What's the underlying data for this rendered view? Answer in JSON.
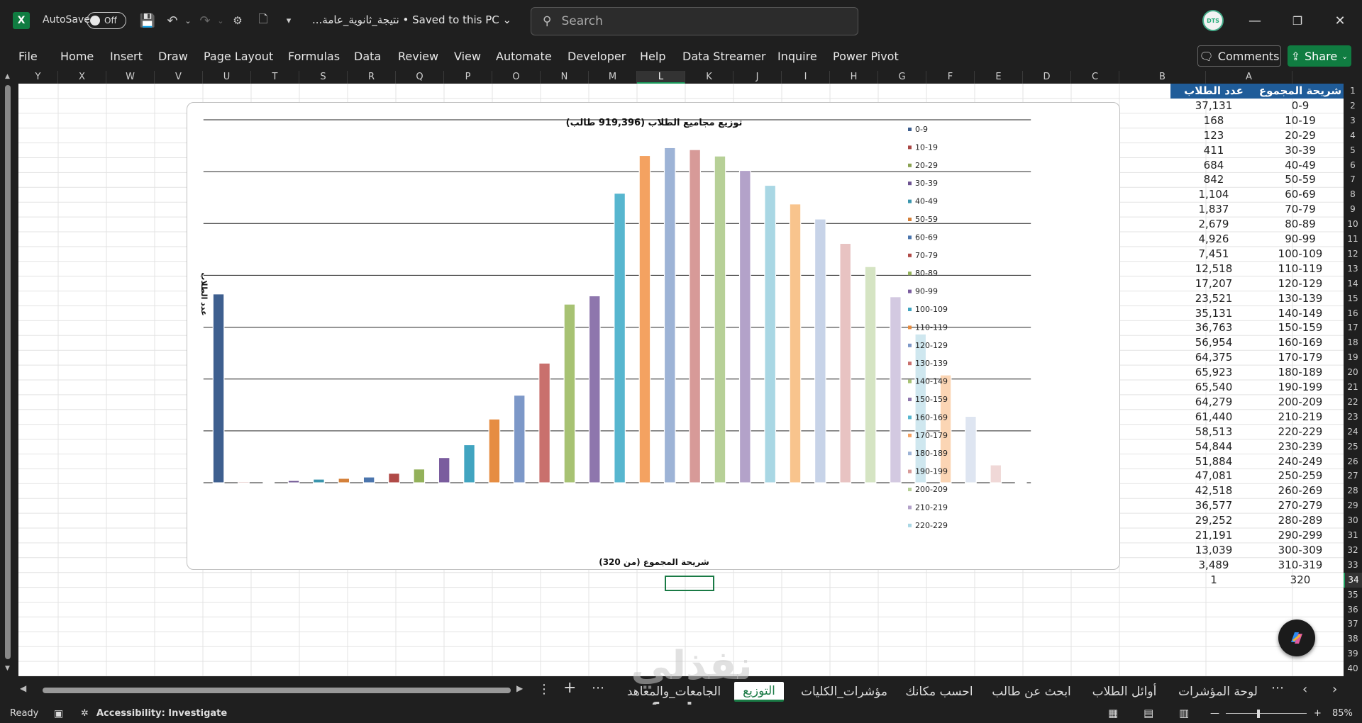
{
  "titlebar": {
    "app_icon": "X",
    "autosave_label": "AutoSave",
    "autosave_state": "Off",
    "doc_title": "...نتيجة_ثانوية_عامة",
    "save_status": "• Saved to this PC",
    "search_placeholder": "Search",
    "avatar_text": "DTS"
  },
  "menu": [
    "File",
    "Home",
    "Insert",
    "Draw",
    "Page Layout",
    "Formulas",
    "Data",
    "Review",
    "View",
    "Automate",
    "Developer",
    "Help",
    "Data Streamer",
    "Inquire",
    "Power Pivot"
  ],
  "buttons": {
    "comments": "Comments",
    "share": "Share"
  },
  "columns": [
    "Y",
    "X",
    "W",
    "V",
    "U",
    "T",
    "S",
    "R",
    "Q",
    "P",
    "O",
    "N",
    "M",
    "L",
    "K",
    "J",
    "I",
    "H",
    "G",
    "F",
    "E",
    "D",
    "C",
    "B",
    "A"
  ],
  "selected_column": "L",
  "rows": [
    "1",
    "2",
    "3",
    "4",
    "5",
    "6",
    "7",
    "8",
    "9",
    "10",
    "11",
    "12",
    "13",
    "14",
    "15",
    "16",
    "17",
    "18",
    "19",
    "20",
    "21",
    "22",
    "23",
    "24",
    "25",
    "26",
    "27",
    "28",
    "29",
    "30",
    "31",
    "32",
    "33",
    "34",
    "35",
    "36",
    "37",
    "38",
    "39",
    "40"
  ],
  "selected_row": "34",
  "table": {
    "header_a": "شريحة المجموع",
    "header_b": "عدد الطلاب",
    "ranges": [
      "0-9",
      "10-19",
      "20-29",
      "30-39",
      "40-49",
      "50-59",
      "60-69",
      "70-79",
      "80-89",
      "90-99",
      "100-109",
      "110-119",
      "120-129",
      "130-139",
      "140-149",
      "150-159",
      "160-169",
      "170-179",
      "180-189",
      "190-199",
      "200-209",
      "210-219",
      "220-229",
      "230-239",
      "240-249",
      "250-259",
      "260-269",
      "270-279",
      "280-289",
      "290-299",
      "300-309",
      "310-319",
      "320"
    ],
    "counts": [
      "37,131",
      "168",
      "123",
      "411",
      "684",
      "842",
      "1,104",
      "1,837",
      "2,679",
      "4,926",
      "7,451",
      "12,518",
      "17,207",
      "23,521",
      "35,131",
      "36,763",
      "56,954",
      "64,375",
      "65,923",
      "65,540",
      "64,279",
      "61,440",
      "58,513",
      "54,844",
      "51,884",
      "47,081",
      "42,518",
      "36,577",
      "29,252",
      "21,191",
      "13,039",
      "3,489",
      "1"
    ]
  },
  "chart_data": {
    "type": "bar",
    "title": "توزيع مجاميع الطلاب (919,396 طالب)",
    "xlabel": "شريحة المجموع (من 320)",
    "ylabel": "عدد الطلاب",
    "categories": [
      "0-9",
      "10-19",
      "20-29",
      "30-39",
      "40-49",
      "50-59",
      "60-69",
      "70-79",
      "80-89",
      "90-99",
      "100-109",
      "110-119",
      "120-129",
      "130-139",
      "140-149",
      "150-159",
      "160-169",
      "170-179",
      "180-189",
      "190-199",
      "200-209",
      "210-219",
      "220-229",
      "230-239",
      "240-249",
      "250-259",
      "260-269",
      "270-279",
      "280-289",
      "290-299",
      "300-309",
      "310-319",
      "320"
    ],
    "values": [
      37131,
      168,
      123,
      411,
      684,
      842,
      1104,
      1837,
      2679,
      4926,
      7451,
      12518,
      17207,
      23521,
      35131,
      36763,
      56954,
      64375,
      65923,
      65540,
      64279,
      61440,
      58513,
      54844,
      51884,
      47081,
      42518,
      36577,
      29252,
      21191,
      13039,
      3489,
      1
    ],
    "legend": [
      "0-9",
      "10-19",
      "20-29",
      "30-39",
      "40-49",
      "50-59",
      "60-69",
      "70-79",
      "80-89",
      "90-99",
      "100-109",
      "110-119",
      "120-129",
      "130-139",
      "140-149",
      "150-159",
      "160-169",
      "170-179",
      "180-189",
      "190-199",
      "200-209",
      "210-219",
      "220-229"
    ],
    "legend_position": "right",
    "ylim": [
      0,
      70000
    ],
    "grid": true,
    "colors": [
      "#3e5f8f",
      "#a94745",
      "#8aa252",
      "#6d5391",
      "#3a95ad",
      "#d4803a",
      "#4b75ad",
      "#b04a47",
      "#93b15a",
      "#7a5c9e",
      "#41a4c0",
      "#e68d42",
      "#7d98c8",
      "#c9706d",
      "#a7c273",
      "#8e76ad",
      "#57b6cf",
      "#f4a261",
      "#9db3d6",
      "#d79a98",
      "#b7d097",
      "#b3a2c9",
      "#a9d7e4",
      "#f8c48d",
      "#c7d3e8",
      "#e8c3c2",
      "#d5e4c3",
      "#d3c9e1",
      "#cfe7ef",
      "#fbd5b4",
      "#dee5f1",
      "#f0d8d7",
      "#e4eed9"
    ]
  },
  "sheet_tabs": [
    "لوحة المؤشرات",
    "أوائل الطلاب",
    "ابحث عن طالب",
    "احسب مكانك",
    "مؤشرات_الكليات",
    "التوزيع",
    "الجامعات_والمعاهد"
  ],
  "active_sheet": "التوزيع",
  "status": {
    "ready": "Ready",
    "accessibility": "Accessibility: Investigate",
    "zoom": "85%"
  },
  "watermark": {
    "big": "نفذلي",
    "small": "nafezly.com"
  }
}
